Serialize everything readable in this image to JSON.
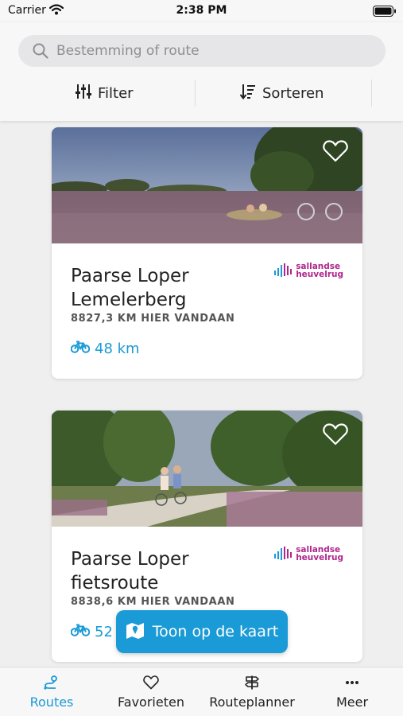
{
  "status_bar": {
    "carrier": "Carrier",
    "time": "2:38 PM"
  },
  "search": {
    "placeholder": "Bestemming of route"
  },
  "toolbar": {
    "filter_label": "Filter",
    "sort_label": "Sorteren"
  },
  "routes": [
    {
      "title_line1": "Paarse Loper",
      "title_line2": "Lemelerberg",
      "distance_away": "8827,3 KM HIER VANDAAN",
      "length": "48 km",
      "brand_line1": "sallandse",
      "brand_line2": "heuvelrug"
    },
    {
      "title_line1": "Paarse Loper",
      "title_line2": "fietsroute",
      "distance_away": "8838,6 KM HIER VANDAAN",
      "length": "52",
      "brand_line1": "sallandse",
      "brand_line2": "heuvelrug"
    }
  ],
  "map_button": {
    "label": "Toon op de kaart"
  },
  "tabbar": {
    "routes": "Routes",
    "favorites": "Favorieten",
    "planner": "Routeplanner",
    "more": "Meer"
  },
  "colors": {
    "accent": "#1a9ad6",
    "brand": "#b0268c"
  }
}
